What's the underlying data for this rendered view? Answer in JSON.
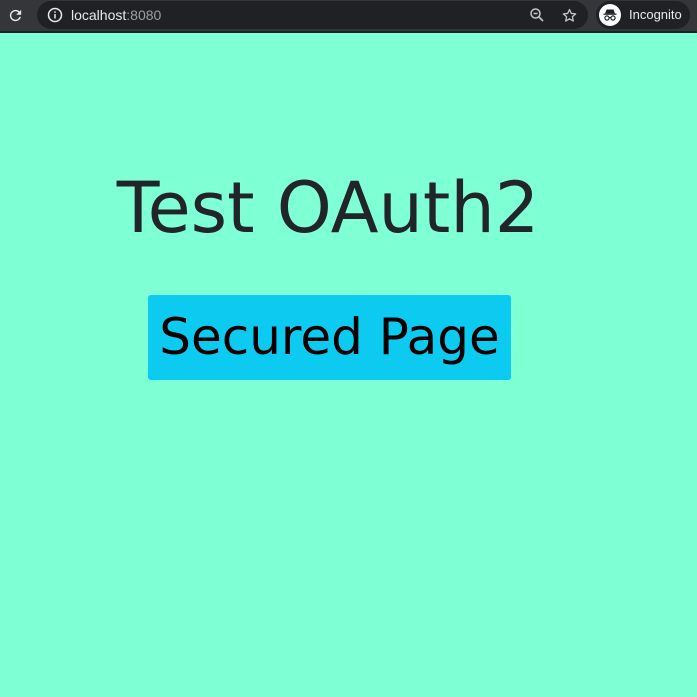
{
  "browser": {
    "url_host": "localhost",
    "url_port": ":8080",
    "profile_label": "Incognito",
    "icons": {
      "reload": "reload-icon",
      "info": "info-icon",
      "zoom": "zoom-icon",
      "star": "star-icon",
      "incognito": "incognito-icon"
    }
  },
  "page": {
    "heading": "Test OAuth2",
    "button_label": "Secured Page",
    "colors": {
      "background": "#7fffd4",
      "button": "#0dcaf0",
      "heading_text": "#212529"
    }
  }
}
